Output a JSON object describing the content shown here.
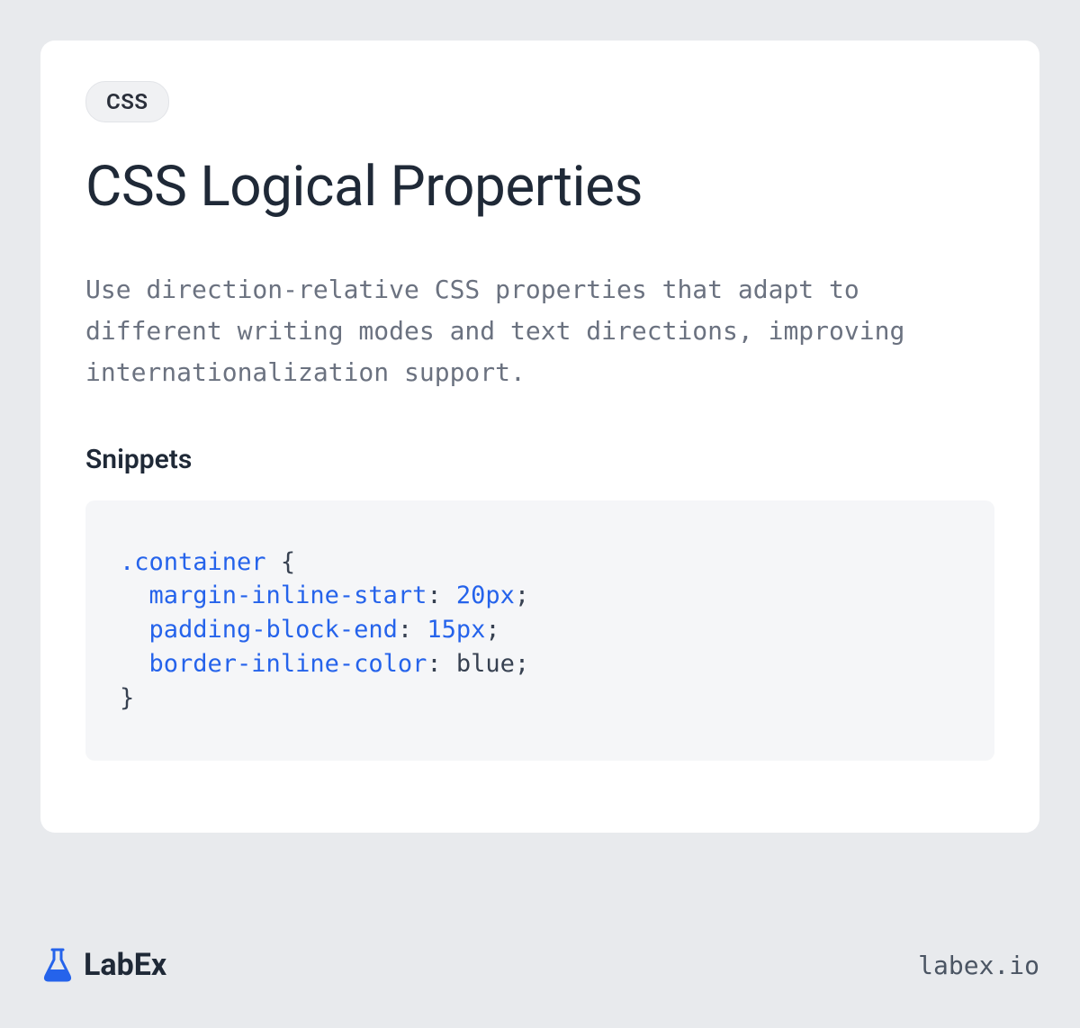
{
  "tag": "CSS",
  "title": "CSS Logical Properties",
  "description": "Use direction-relative CSS properties that adapt to different writing modes and text directions, improving internationalization support.",
  "snippets_heading": "Snippets",
  "code": {
    "selector": ".container",
    "open_brace": " {",
    "lines": [
      {
        "indent": "  ",
        "prop": "margin-inline-start",
        "colon": ": ",
        "value": "20px",
        "semi": ";"
      },
      {
        "indent": "  ",
        "prop": "padding-block-end",
        "colon": ": ",
        "value": "15px",
        "semi": ";"
      },
      {
        "indent": "  ",
        "prop": "border-inline-color",
        "colon": ": ",
        "value_ident": "blue",
        "semi": ";"
      }
    ],
    "close_brace": "}"
  },
  "brand": "LabEx",
  "domain": "labex.io",
  "colors": {
    "page_bg": "#e8eaed",
    "card_bg": "#ffffff",
    "tag_bg": "#f0f1f3",
    "code_bg": "#f5f6f8",
    "text_dark": "#1f2937",
    "text_muted": "#6b7280",
    "accent_blue": "#2563eb"
  }
}
